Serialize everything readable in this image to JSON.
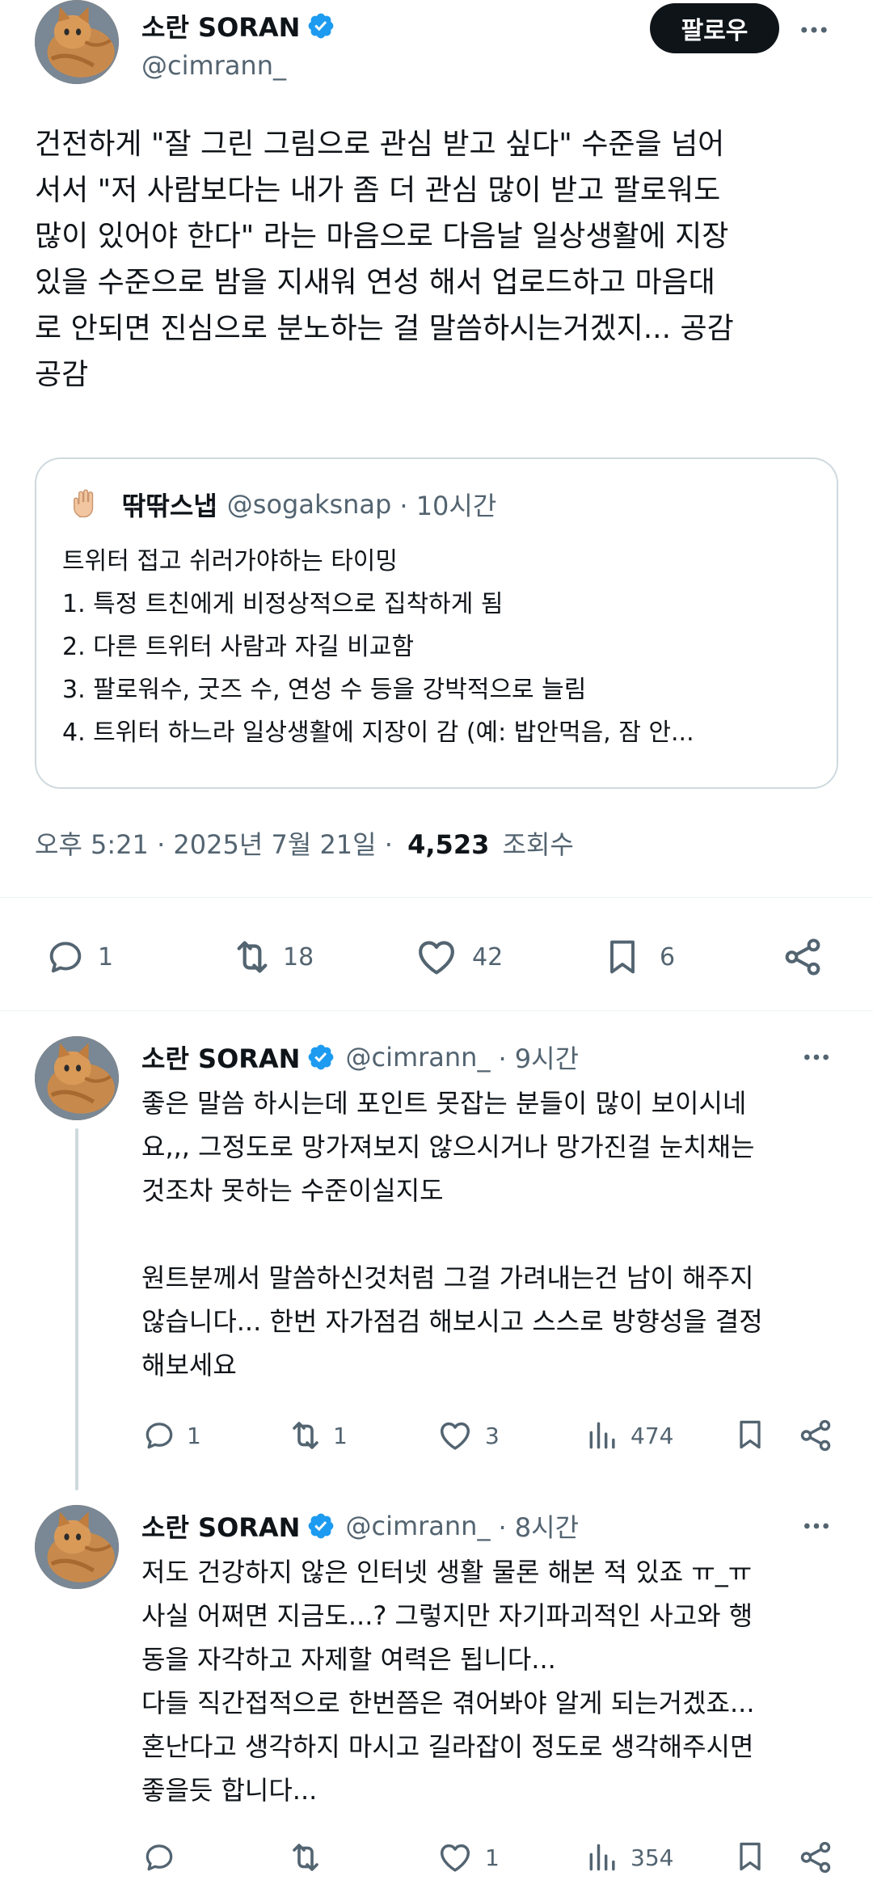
{
  "main_tweet": {
    "author_name": "소란 SORAN",
    "handle": "@cimrann_",
    "follow_label": "팔로우",
    "text_lines": [
      "건전하게 \"잘 그린 그림으로 관심 받고 싶다\" 수준을 넘어",
      "서서 \"저 사람보다는 내가 좀 더 관심 많이 받고 팔로워도",
      "많이 있어야 한다\" 라는 마음으로 다음날 일상생활에 지장",
      "있을 수준으로 밤을 지새워 연성 해서 업로드하고 마음대",
      "로 안되면 진심으로 분노하는 걸 말씀하시는거겠지... 공감",
      "공감"
    ],
    "quote": {
      "author_name": "딲딲스냅",
      "handle": "@sogaksnap",
      "time": "· 10시간",
      "lines": [
        "트위터 접고 쉬러가야하는 타이밍",
        "1. 특정 트친에게 비정상적으로 집착하게 됨",
        "2. 다른 트위터 사람과 자길 비교함",
        "3. 팔로워수, 굿즈 수, 연성 수 등을 강박적으로 늘림",
        "4. 트위터 하느라 일상생활에 지장이 감 (예: 밥안먹음, 잠 안..."
      ]
    },
    "timestamp": "오후 5:21 · 2025년 7월 21일 ·",
    "views_count": "4,523",
    "views_label": "조회수",
    "replies": "1",
    "retweets": "18",
    "likes": "42",
    "bookmarks": "6"
  },
  "replies": [
    {
      "author_name": "소란 SORAN",
      "handle": "@cimrann_",
      "time": "· 9시간",
      "text_lines": [
        "좋은 말씀 하시는데 포인트 못잡는 분들이 많이 보이시네",
        "요,,, 그정도로 망가져보지 않으시거나 망가진걸 눈치채는",
        "것조차 못하는 수준이실지도",
        "",
        "원트분께서 말씀하신것처럼 그걸 가려내는건 남이 해주지",
        "않습니다... 한번 자가점검 해보시고 스스로 방향성을 결정",
        "해보세요"
      ],
      "replies": "1",
      "retweets": "1",
      "likes": "3",
      "views": "474"
    },
    {
      "author_name": "소란 SORAN",
      "handle": "@cimrann_",
      "time": "· 8시간",
      "text_lines": [
        "저도 건강하지 않은 인터넷 생활 물론 해본 적 있죠 ㅠ_ㅠ",
        "사실 어쩌면 지금도...? 그렇지만 자기파괴적인 사고와 행",
        "동을 자각하고 자제할 여력은 됩니다...",
        "다들 직간접적으로 한번쯤은 겪어봐야 알게 되는거겠죠...",
        "혼난다고 생각하지 마시고 길라잡이 정도로 생각해주시면",
        "좋을듯 합니다..."
      ],
      "replies": "",
      "retweets": "",
      "likes": "1",
      "views": "354"
    }
  ],
  "colors": {
    "text": "#0f1419",
    "muted": "#536471",
    "verified": "#1d9bf0",
    "border": "#cfd9de"
  }
}
